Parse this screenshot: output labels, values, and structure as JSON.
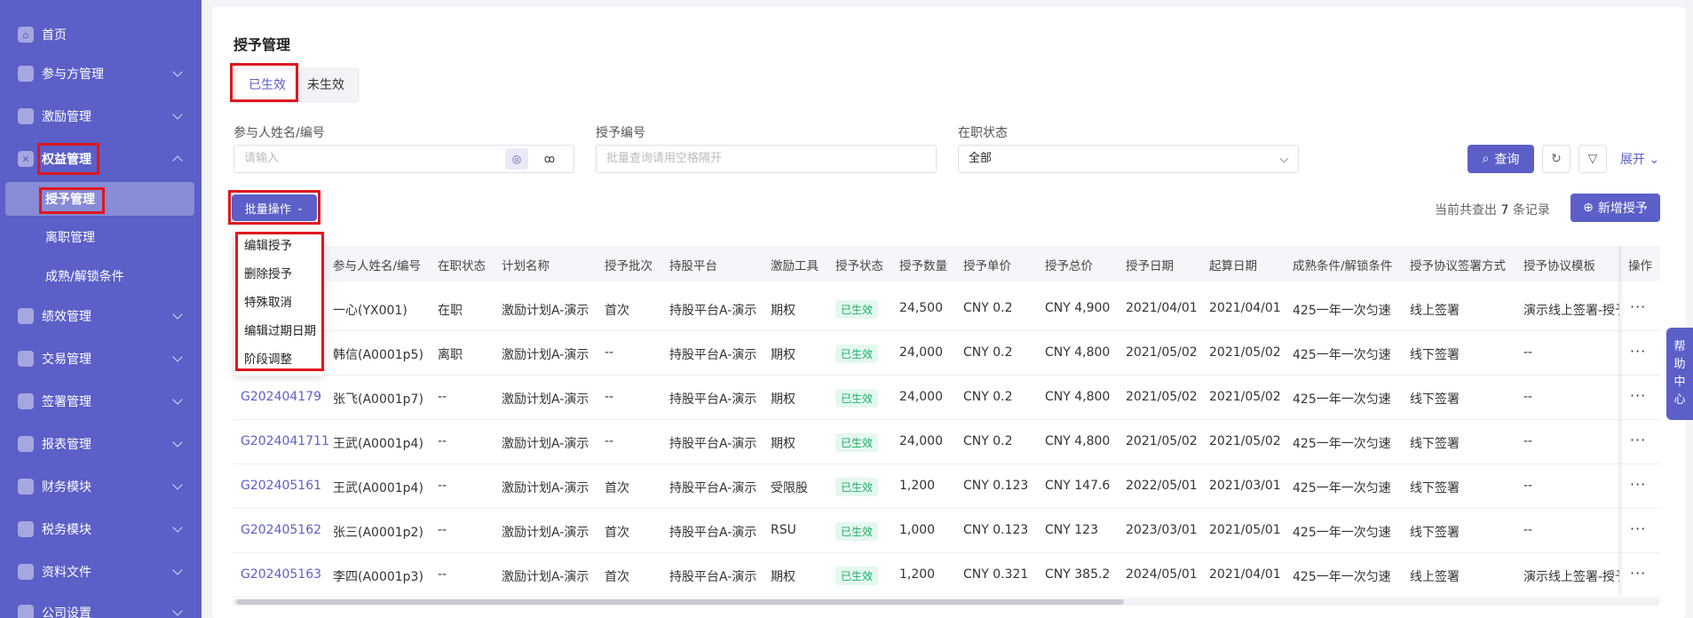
{
  "sidebar": {
    "items": [
      {
        "label": "首页",
        "icon": "home-icon"
      },
      {
        "label": "参与方管理",
        "icon": "users-icon"
      },
      {
        "label": "激励管理",
        "icon": "gift-icon"
      },
      {
        "label": "权益管理",
        "icon": "equity-icon"
      },
      {
        "label": "绩效管理",
        "icon": "chart-icon"
      },
      {
        "label": "交易管理",
        "icon": "exchange-icon"
      },
      {
        "label": "签署管理",
        "icon": "sign-icon"
      },
      {
        "label": "报表管理",
        "icon": "report-icon"
      },
      {
        "label": "财务模块",
        "icon": "finance-icon"
      },
      {
        "label": "税务模块",
        "icon": "tax-icon"
      },
      {
        "label": "资料文件",
        "icon": "folder-icon"
      },
      {
        "label": "公司设置",
        "icon": "settings-icon"
      }
    ],
    "sub_items": [
      "授予管理",
      "离职管理",
      "成熟/解锁条件"
    ]
  },
  "page": {
    "title": "授予管理",
    "tabs": [
      "已生效",
      "未生效"
    ]
  },
  "filters": {
    "participant_label": "参与人姓名/编号",
    "participant_placeholder": "请输入",
    "grant_no_label": "授予编号",
    "grant_no_placeholder": "批量查询请用空格隔开",
    "status_label": "在职状态",
    "status_value": "全部",
    "query_label": "查询",
    "expand_label": "展开"
  },
  "toolbar": {
    "batch_label": "批量操作",
    "batch_menu": [
      "编辑授予",
      "删除授予",
      "特殊取消",
      "编辑过期日期",
      "阶段调整"
    ],
    "count_prefix": "当前共查出",
    "count_value": "7",
    "count_suffix": "条记录",
    "add_label": "新增授予"
  },
  "table": {
    "columns": [
      "参与人姓名/编号",
      "在职状态",
      "计划名称",
      "授予批次",
      "持股平台",
      "激励工具",
      "授予状态",
      "授予数量",
      "授予单价",
      "授予总价",
      "授予日期",
      "起算日期",
      "成熟条件/解锁条件",
      "授予协议签署方式",
      "授予协议模板",
      "操作"
    ],
    "rows": [
      {
        "grant_no": "",
        "name": "一心(YX001)",
        "emp": "在职",
        "plan": "激励计划A-演示",
        "batch": "首次",
        "platform": "持股平台A-演示",
        "tool": "期权",
        "status": "已生效",
        "qty": "24,500",
        "price": "CNY  0.2",
        "total": "CNY  4,900",
        "grant_date": "2021/04/01",
        "start_date": "2021/04/01",
        "cond": "425一年一次匀速",
        "sign": "线上签署",
        "tmpl": "演示线上签署-授予"
      },
      {
        "grant_no": "",
        "name": "韩信(A0001p5)",
        "emp": "离职",
        "plan": "激励计划A-演示",
        "batch": "--",
        "platform": "持股平台A-演示",
        "tool": "期权",
        "status": "已生效",
        "qty": "24,000",
        "price": "CNY  0.2",
        "total": "CNY  4,800",
        "grant_date": "2021/05/02",
        "start_date": "2021/05/02",
        "cond": "425一年一次匀速",
        "sign": "线下签署",
        "tmpl": "--"
      },
      {
        "grant_no": "G202404179",
        "name": "张飞(A0001p7)",
        "emp": "--",
        "plan": "激励计划A-演示",
        "batch": "--",
        "platform": "持股平台A-演示",
        "tool": "期权",
        "status": "已生效",
        "qty": "24,000",
        "price": "CNY  0.2",
        "total": "CNY  4,800",
        "grant_date": "2021/05/02",
        "start_date": "2021/05/02",
        "cond": "425一年一次匀速",
        "sign": "线下签署",
        "tmpl": "--"
      },
      {
        "grant_no": "G2024041711",
        "name": "王武(A0001p4)",
        "emp": "--",
        "plan": "激励计划A-演示",
        "batch": "--",
        "platform": "持股平台A-演示",
        "tool": "期权",
        "status": "已生效",
        "qty": "24,000",
        "price": "CNY  0.2",
        "total": "CNY  4,800",
        "grant_date": "2021/05/02",
        "start_date": "2021/05/02",
        "cond": "425一年一次匀速",
        "sign": "线下签署",
        "tmpl": "--"
      },
      {
        "grant_no": "G202405161",
        "name": "王武(A0001p4)",
        "emp": "--",
        "plan": "激励计划A-演示",
        "batch": "首次",
        "platform": "持股平台A-演示",
        "tool": "受限股",
        "status": "已生效",
        "qty": "1,200",
        "price": "CNY  0.123",
        "total": "CNY  147.6",
        "grant_date": "2022/05/01",
        "start_date": "2021/03/01",
        "cond": "425一年一次匀速",
        "sign": "线下签署",
        "tmpl": "--"
      },
      {
        "grant_no": "G202405162",
        "name": "张三(A0001p2)",
        "emp": "--",
        "plan": "激励计划A-演示",
        "batch": "首次",
        "platform": "持股平台A-演示",
        "tool": "RSU",
        "status": "已生效",
        "qty": "1,000",
        "price": "CNY  0.123",
        "total": "CNY  123",
        "grant_date": "2023/03/01",
        "start_date": "2021/05/01",
        "cond": "425一年一次匀速",
        "sign": "线下签署",
        "tmpl": "--"
      },
      {
        "grant_no": "G202405163",
        "name": "李四(A0001p3)",
        "emp": "--",
        "plan": "激励计划A-演示",
        "batch": "首次",
        "platform": "持股平台A-演示",
        "tool": "期权",
        "status": "已生效",
        "qty": "1,200",
        "price": "CNY  0.321",
        "total": "CNY  385.2",
        "grant_date": "2024/05/01",
        "start_date": "2021/04/01",
        "cond": "425一年一次匀速",
        "sign": "线上签署",
        "tmpl": "演示线上签署-授予"
      }
    ],
    "more_glyph": "···"
  },
  "help": {
    "chars": [
      "帮",
      "助",
      "中",
      "心"
    ]
  },
  "colors": {
    "brand": "#5b5fc7",
    "highlight": "#e0161e",
    "success": "#1db06a"
  }
}
